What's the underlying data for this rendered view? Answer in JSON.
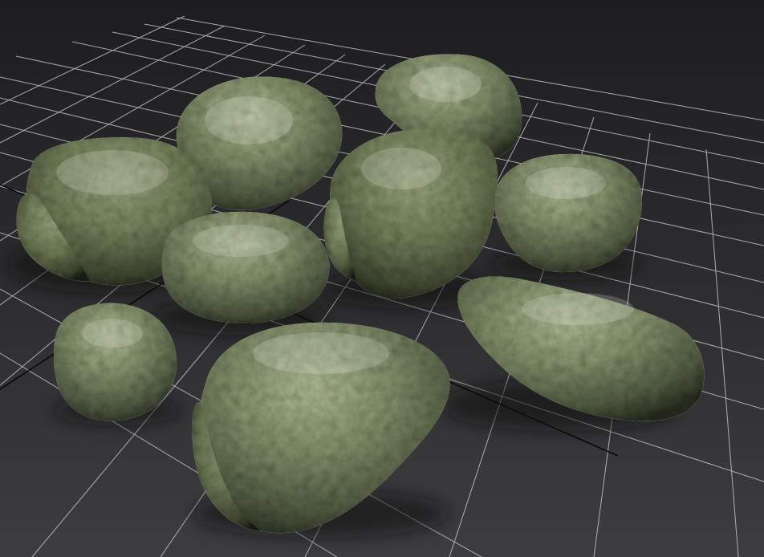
{
  "viewport": {
    "background_top": "#1d1d1f",
    "background_bottom": "#3d3d40",
    "grid_color": "#d8d8d8",
    "axis_color": "#050505"
  },
  "scene": {
    "object_count": 11,
    "object_type": "rock",
    "rock_base_color": "#7f8772",
    "rock_moss_color": "#7d8b5a",
    "rock_shadow_color": "#2d3028"
  }
}
